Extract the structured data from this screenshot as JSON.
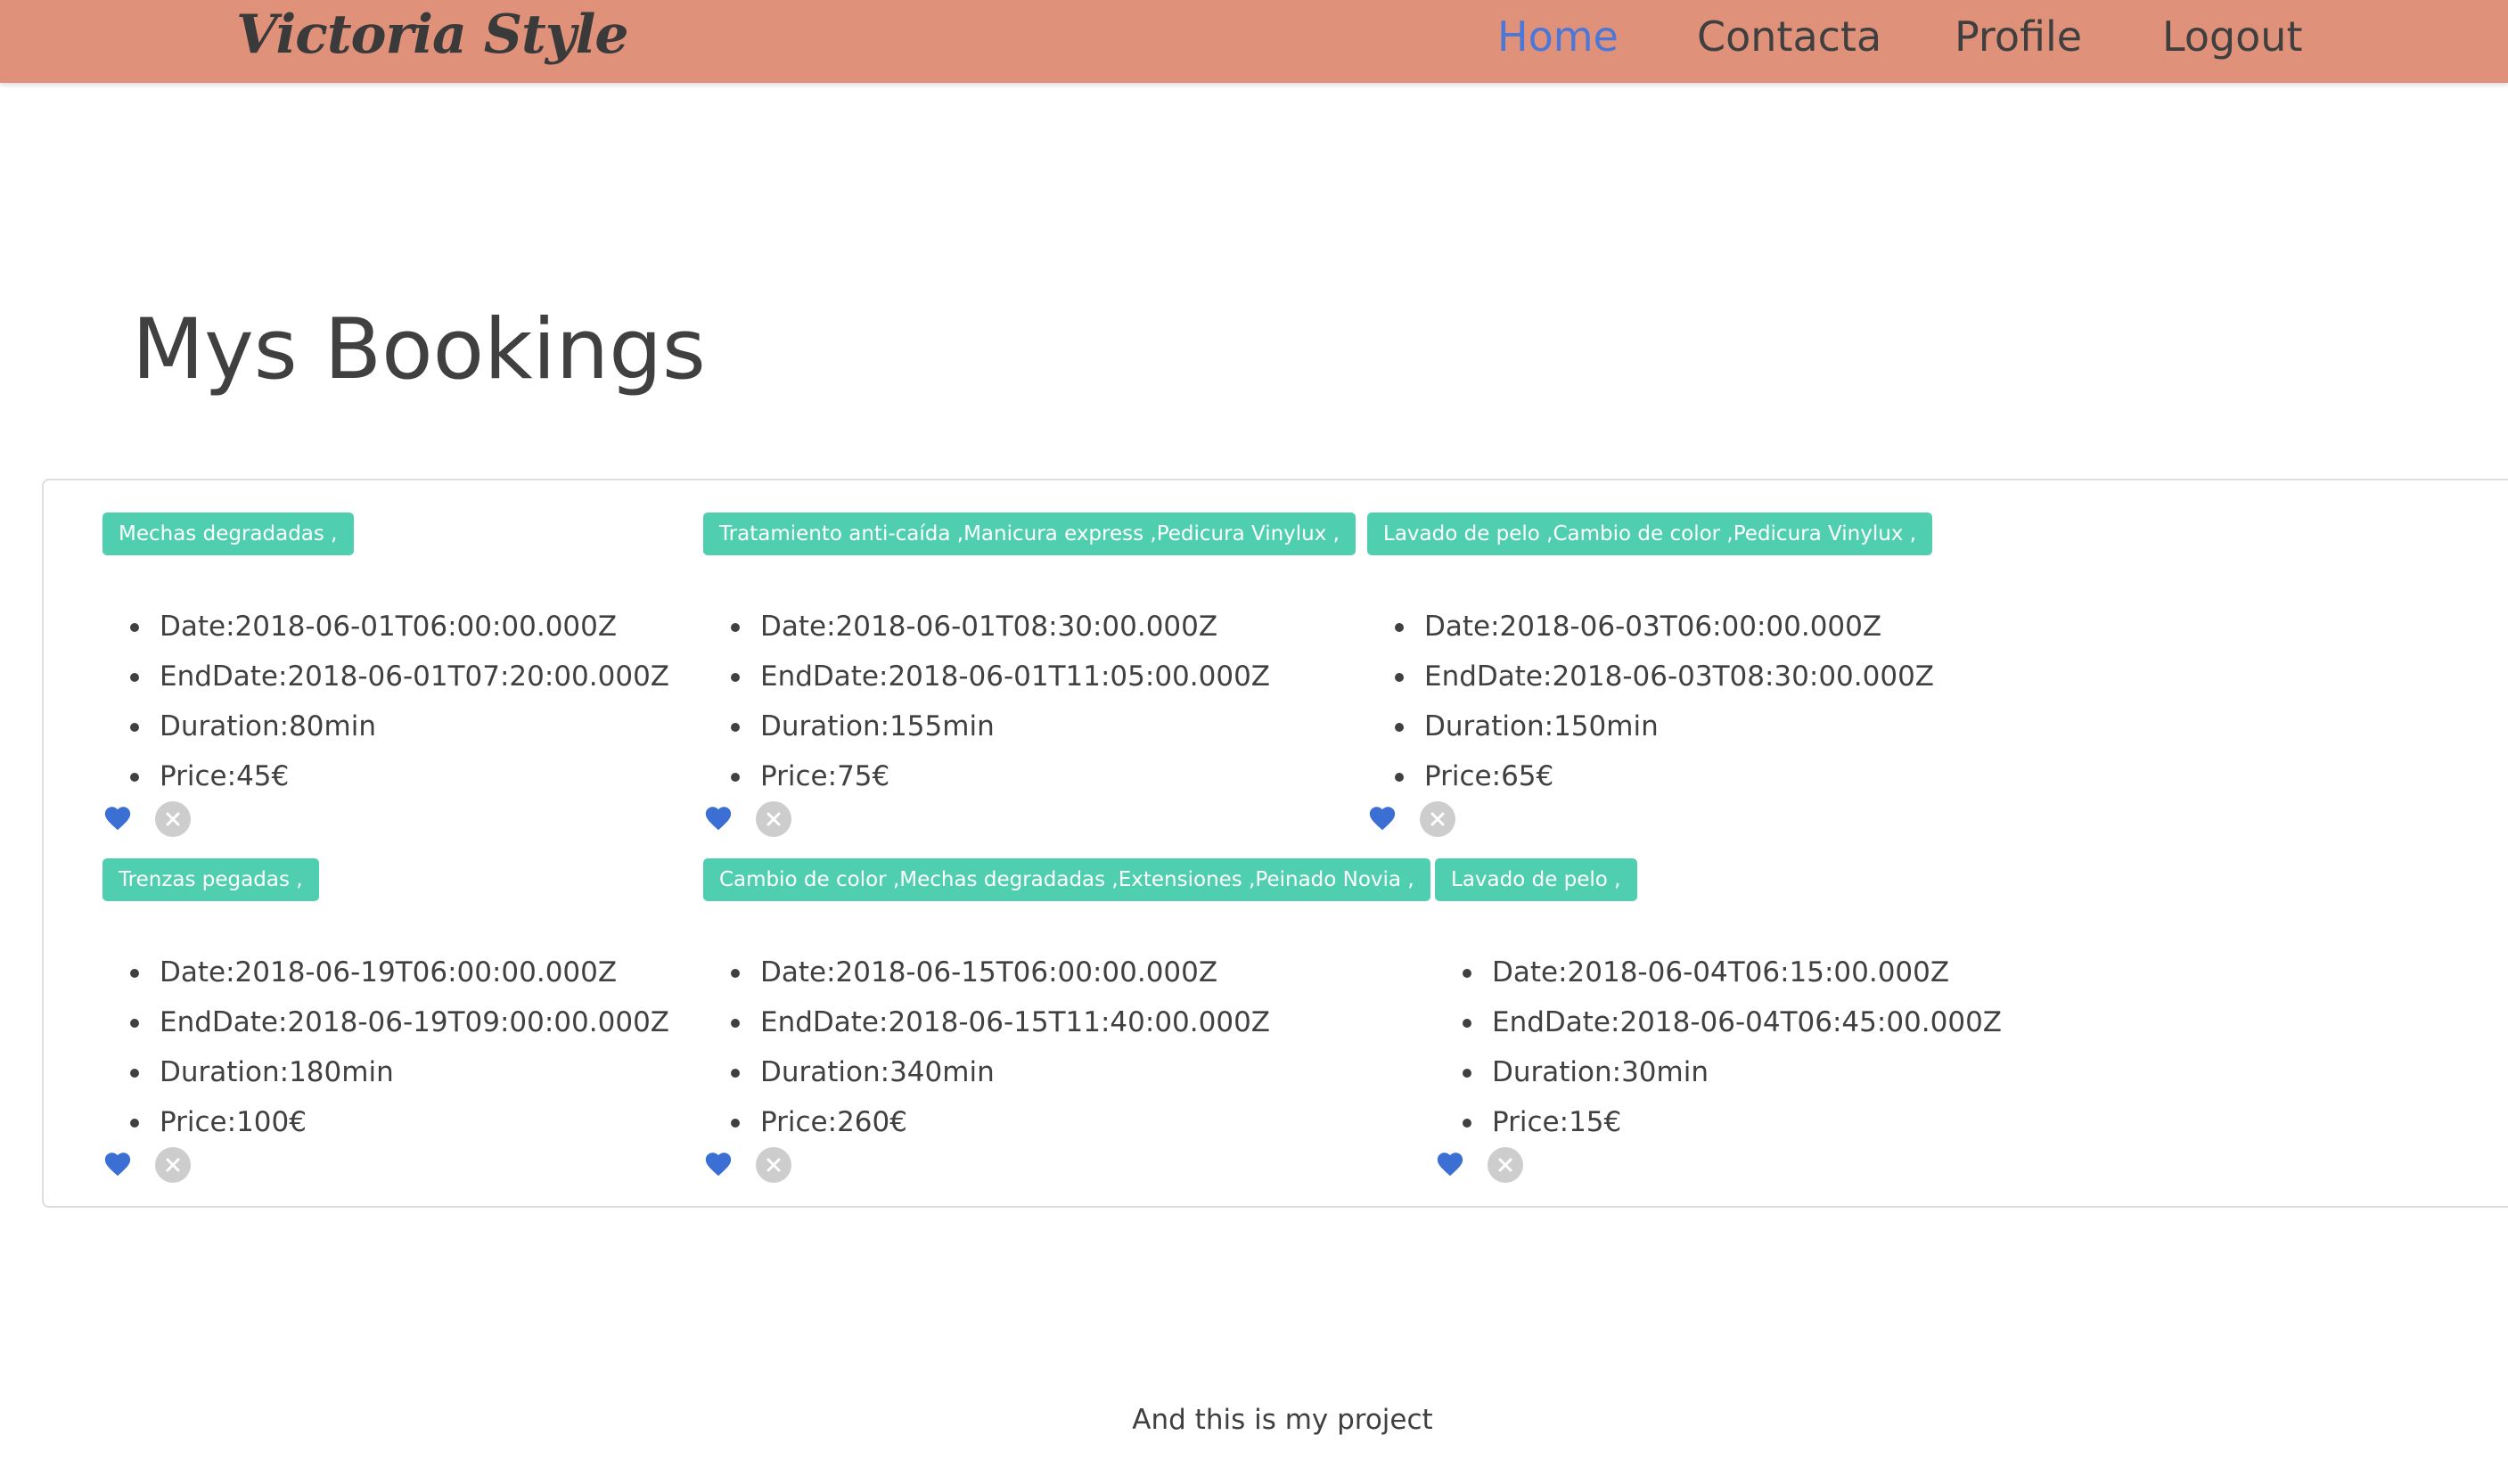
{
  "navbar": {
    "brand": "Victoria Style",
    "links": [
      {
        "label": "Home",
        "active": true
      },
      {
        "label": "Contacta",
        "active": false
      },
      {
        "label": "Profile",
        "active": false
      },
      {
        "label": "Logout",
        "active": false
      }
    ],
    "background_color": "#e0917a",
    "active_color": "#4a77d8"
  },
  "main": {
    "title": "Mys Bookings"
  },
  "bookings": [
    {
      "services": "Mechas degradadas ,",
      "date": "Date:2018-06-01T06:00:00.000Z",
      "end_date": "EndDate:2018-06-01T07:20:00.000Z",
      "duration": "Duration:80min",
      "price": "Price:45€"
    },
    {
      "services": "Tratamiento anti-caída ,Manicura express ,Pedicura Vinylux ,",
      "date": "Date:2018-06-01T08:30:00.000Z",
      "end_date": "EndDate:2018-06-01T11:05:00.000Z",
      "duration": "Duration:155min",
      "price": "Price:75€"
    },
    {
      "services": "Lavado de pelo ,Cambio de color ,Pedicura Vinylux ,",
      "date": "Date:2018-06-03T06:00:00.000Z",
      "end_date": "EndDate:2018-06-03T08:30:00.000Z",
      "duration": "Duration:150min",
      "price": "Price:65€"
    },
    {
      "services": "Trenzas pegadas ,",
      "date": "Date:2018-06-19T06:00:00.000Z",
      "end_date": "EndDate:2018-06-19T09:00:00.000Z",
      "duration": "Duration:180min",
      "price": "Price:100€"
    },
    {
      "services": "Cambio de color ,Mechas degradadas ,Extensiones ,Peinado Novia ,",
      "date": "Date:2018-06-15T06:00:00.000Z",
      "end_date": "EndDate:2018-06-15T11:40:00.000Z",
      "duration": "Duration:340min",
      "price": "Price:260€"
    },
    {
      "services": "Lavado de pelo ,",
      "date": "Date:2018-06-04T06:15:00.000Z",
      "end_date": "EndDate:2018-06-04T06:45:00.000Z",
      "duration": "Duration:30min",
      "price": "Price:15€"
    }
  ],
  "card_actions": {
    "like_icon": "heart-icon",
    "like_color": "#3b6fd4",
    "remove_icon": "close-icon",
    "tag_color": "#4fcfb0"
  },
  "footer": {
    "text": "And this is my project"
  }
}
